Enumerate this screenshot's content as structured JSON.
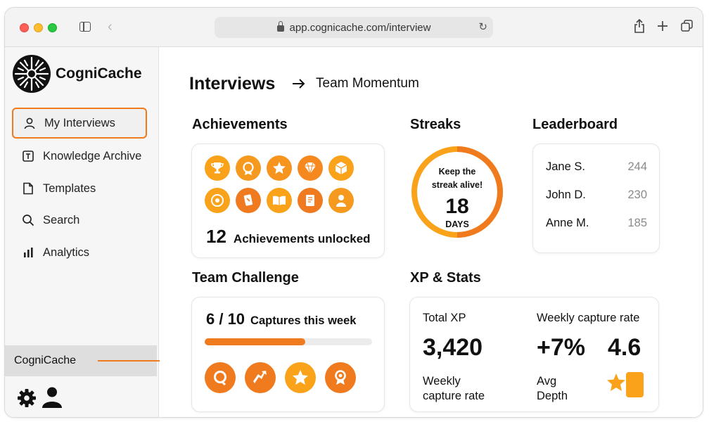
{
  "browser": {
    "url": "app.cognicache.com/interview"
  },
  "sidebar": {
    "brand": "CogniCache",
    "items": [
      {
        "label": "My Interviews",
        "icon": "user-icon"
      },
      {
        "label": "Knowledge Archive",
        "icon": "text-box-icon"
      },
      {
        "label": "Templates",
        "icon": "document-icon"
      },
      {
        "label": "Search",
        "icon": "search-icon"
      },
      {
        "label": "Analytics",
        "icon": "bar-chart-icon"
      }
    ],
    "active_index": 0,
    "coach_label": "CogniCache"
  },
  "colors": {
    "accent": "#f07a1e",
    "badge_light": "#f9a21a",
    "badge_dark": "#ef7a1f"
  },
  "header": {
    "title": "Interviews",
    "crumb": "Team Momentum"
  },
  "achievements": {
    "heading": "Achievements",
    "count": "12",
    "count_label": "Achievements unlocked",
    "badges": [
      "trophy-badge-icon",
      "medal-badge-icon",
      "star-badge-icon",
      "gem-badge-icon",
      "cube-badge-icon",
      "coin-badge-icon",
      "card-badge-icon",
      "book-badge-icon",
      "scroll-badge-icon",
      "person-badge-icon"
    ]
  },
  "streaks": {
    "heading": "Streaks",
    "message_line1": "Keep the",
    "message_line2": "streak alive!",
    "value": "18",
    "unit": "DAYS"
  },
  "leaderboard": {
    "heading": "Leaderboard",
    "rows": [
      {
        "name": "Jane S.",
        "score": "244"
      },
      {
        "name": "John D.",
        "score": "230"
      },
      {
        "name": "Anne M.",
        "score": "185"
      }
    ]
  },
  "team_challenge": {
    "heading": "Team Challenge",
    "count": "6 / 10",
    "label": "Captures this week",
    "progress_fraction": 0.6,
    "badges": [
      "ring-badge-icon",
      "arrow-badge-icon",
      "star-badge-icon",
      "ribbon-badge-icon"
    ]
  },
  "xp_stats": {
    "heading": "XP & Stats",
    "total_xp_label": "Total XP",
    "total_xp_value": "3,420",
    "weekly_label_top": "Weekly capture rate",
    "weekly_value": "+7%",
    "depth_value": "4.6",
    "weekly_label_line1": "Weekly",
    "weekly_label_line2": "capture rate",
    "depth_label_line1": "Avg",
    "depth_label_line2": "Depth"
  }
}
